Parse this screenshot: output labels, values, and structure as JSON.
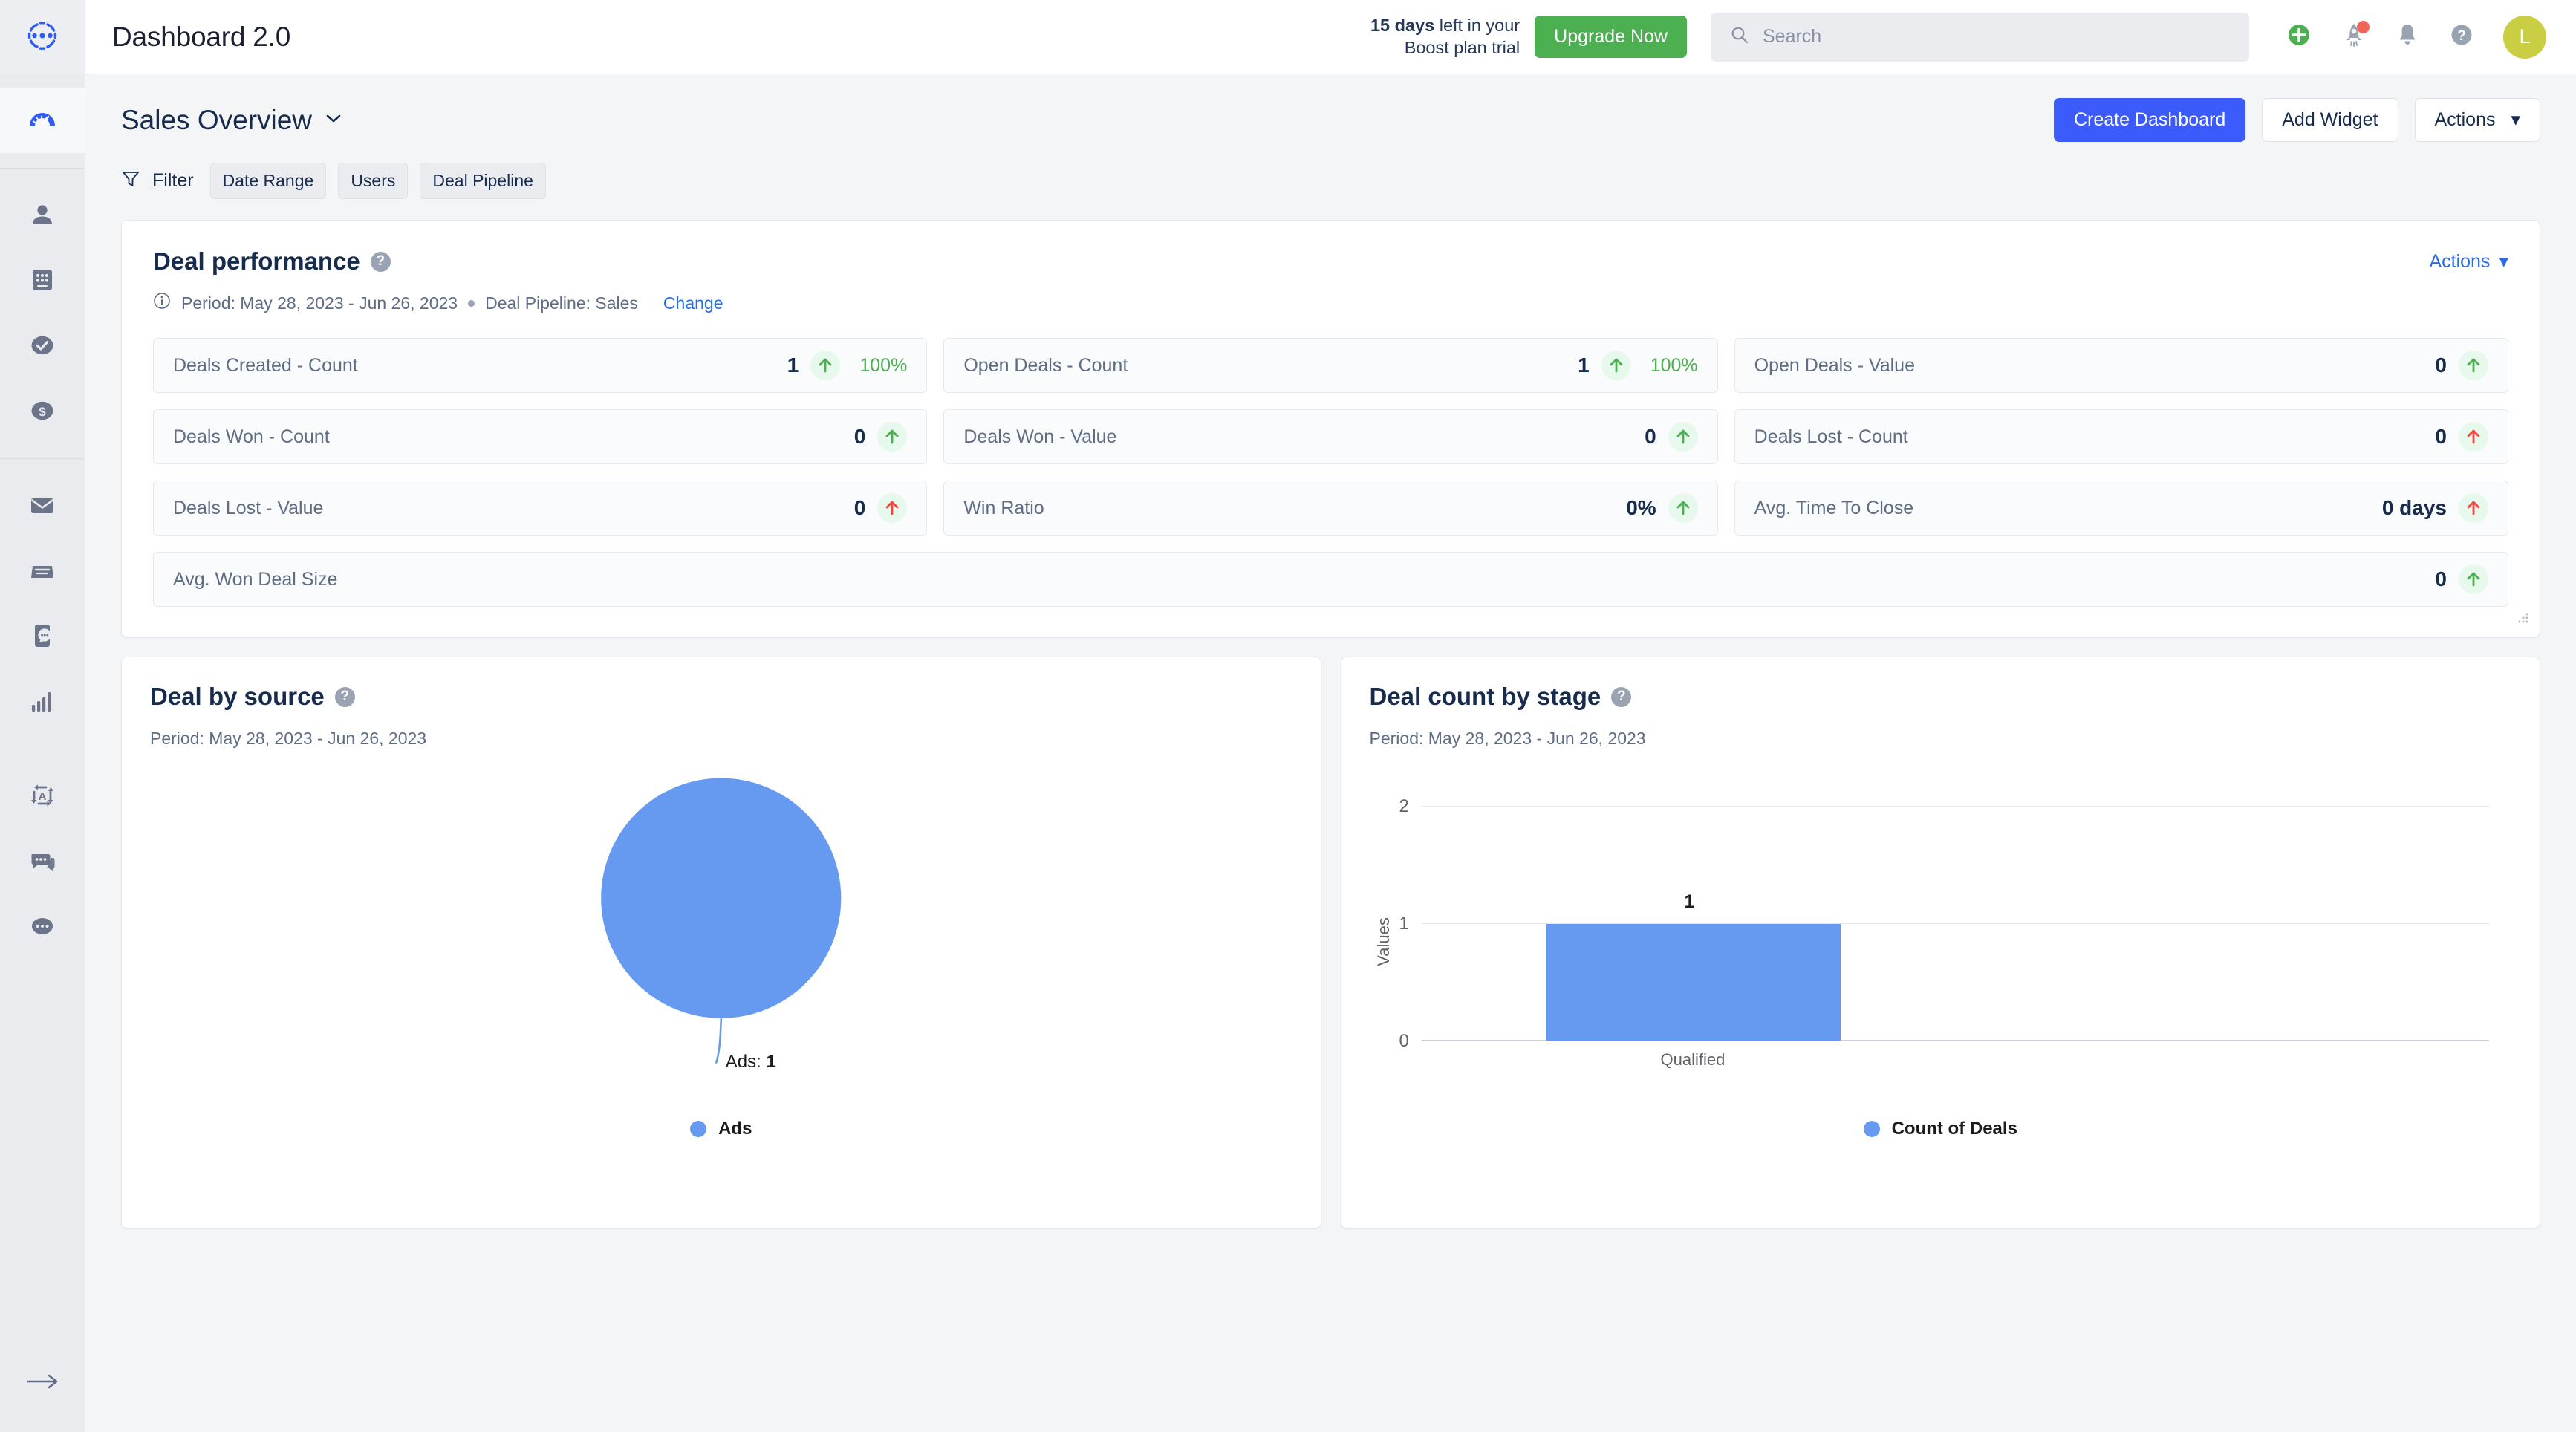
{
  "sidebar": {
    "logo_icon": "crm-logo-icon",
    "groups": [
      {
        "items": [
          {
            "icon": "dashboard-speedometer-icon",
            "active": true
          }
        ]
      },
      {
        "items": [
          {
            "icon": "contacts-person-icon",
            "active": false
          },
          {
            "icon": "companies-grid-icon",
            "active": false
          },
          {
            "icon": "tasks-check-circle-icon",
            "active": false
          },
          {
            "icon": "deals-dollar-circle-icon",
            "active": false
          }
        ]
      },
      {
        "items": [
          {
            "icon": "email-envelope-icon",
            "active": false
          },
          {
            "icon": "inbox-tray-icon",
            "active": false
          },
          {
            "icon": "sms-phone-chat-icon",
            "active": false
          },
          {
            "icon": "reports-bar-chart-icon",
            "active": false
          }
        ]
      },
      {
        "items": [
          {
            "icon": "automation-cycle-icon",
            "active": false
          },
          {
            "icon": "chat-bubbles-icon",
            "active": false
          },
          {
            "icon": "more-ellipsis-icon",
            "active": false
          }
        ]
      }
    ],
    "collapse_icon": "arrow-right-expand-icon"
  },
  "topbar": {
    "app_title": "Dashboard 2.0",
    "trial_strong": "15 days",
    "trial_rest": " left in your",
    "trial_line2": "Boost plan trial",
    "upgrade_label": "Upgrade Now",
    "search_placeholder": "Search",
    "search_value": "",
    "search_icon": "search-icon",
    "add_icon": "plus-circle-icon",
    "rocket_icon": "rocket-icon",
    "bell_icon": "bell-notification-icon",
    "help_icon": "help-question-icon",
    "avatar_initial": "L"
  },
  "page": {
    "title": "Sales Overview",
    "title_caret_icon": "chevron-down-icon",
    "buttons": {
      "create_dashboard": "Create Dashboard",
      "add_widget": "Add Widget",
      "actions": "Actions"
    },
    "filter": {
      "icon": "filter-funnel-icon",
      "label": "Filter",
      "chips": [
        "Date Range",
        "Users",
        "Deal Pipeline"
      ]
    }
  },
  "deal_performance": {
    "title": "Deal performance",
    "help_icon": "help-question-icon",
    "actions_label": "Actions",
    "info_icon": "info-circle-icon",
    "period": "Period: May 28, 2023 - Jun 26, 2023",
    "pipeline": "Deal Pipeline: Sales",
    "change_link": "Change",
    "metrics": [
      {
        "label": "Deals Created - Count",
        "value": "1",
        "delta": "100%",
        "trend": "up",
        "trend_color": "#4caf50"
      },
      {
        "label": "Open Deals - Count",
        "value": "1",
        "delta": "100%",
        "trend": "up",
        "trend_color": "#4caf50"
      },
      {
        "label": "Open Deals - Value",
        "value": "0",
        "delta": "",
        "trend": "up",
        "trend_color": "#4caf50"
      },
      {
        "label": "Deals Won - Count",
        "value": "0",
        "delta": "",
        "trend": "up",
        "trend_color": "#4caf50"
      },
      {
        "label": "Deals Won - Value",
        "value": "0",
        "delta": "",
        "trend": "up",
        "trend_color": "#4caf50"
      },
      {
        "label": "Deals Lost - Count",
        "value": "0",
        "delta": "",
        "trend": "up",
        "trend_color": "#f0483e"
      },
      {
        "label": "Deals Lost - Value",
        "value": "0",
        "delta": "",
        "trend": "up",
        "trend_color": "#f0483e"
      },
      {
        "label": "Win Ratio",
        "value": "0%",
        "delta": "",
        "trend": "up",
        "trend_color": "#4caf50"
      },
      {
        "label": "Avg. Time To Close",
        "value": "0 days",
        "delta": "",
        "trend": "up",
        "trend_color": "#f0483e"
      },
      {
        "label": "Avg. Won Deal Size",
        "value": "0",
        "delta": "",
        "trend": "up",
        "trend_color": "#4caf50"
      }
    ],
    "resize_icon": "resize-grip-icon"
  },
  "deal_by_source": {
    "title": "Deal by source",
    "help_icon": "help-question-icon",
    "period": "Period: May 28, 2023 - Jun 26, 2023",
    "slice_label": "Ads: ",
    "slice_value": "1",
    "legend_label": "Ads"
  },
  "deal_count_by_stage": {
    "title": "Deal count by stage",
    "help_icon": "help-question-icon",
    "period": "Period: May 28, 2023 - Jun 26, 2023",
    "legend_label": "Count of Deals"
  },
  "chart_data": [
    {
      "type": "pie",
      "title": "Deal by source",
      "labels": [
        "Ads"
      ],
      "values": [
        1
      ],
      "colors": [
        "#6699f0"
      ],
      "annotations": [
        "Ads: 1"
      ],
      "legend": [
        "Ads"
      ],
      "legend_position": "bottom"
    },
    {
      "type": "bar",
      "title": "Deal count by stage",
      "categories": [
        "Qualified"
      ],
      "values": [
        1
      ],
      "data_labels": [
        "1"
      ],
      "series": [
        {
          "name": "Count of Deals",
          "values": [
            1
          ]
        }
      ],
      "xlabel": "",
      "ylabel": "Values",
      "ylim": [
        0,
        2
      ],
      "yticks": [
        "0",
        "1",
        "2"
      ],
      "grid": true,
      "color": "#6699f0",
      "legend": [
        "Count of Deals"
      ],
      "legend_position": "bottom"
    }
  ]
}
